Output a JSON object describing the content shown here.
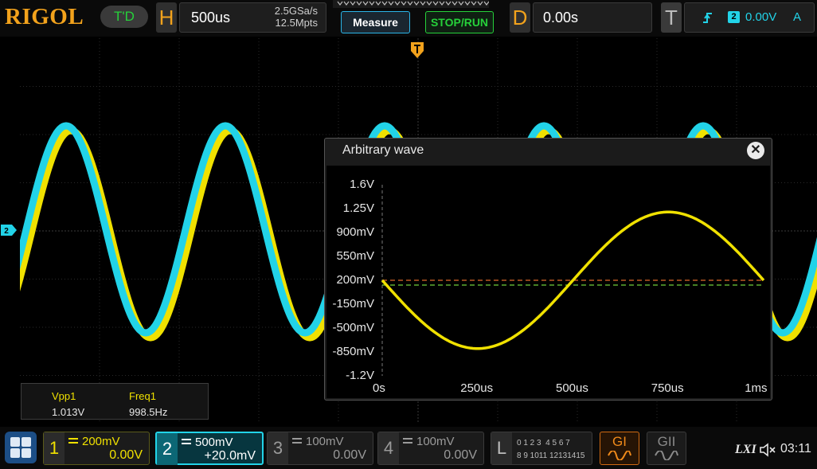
{
  "brand": "RIGOL",
  "trigger_status": "T'D",
  "horizontal": {
    "letter": "H",
    "timebase": "500us",
    "sample_rate": "2.5GSa/s",
    "memory_depth": "12.5Mpts"
  },
  "buttons": {
    "measure": "Measure",
    "stop_run": "STOP/RUN"
  },
  "delay": {
    "letter": "D",
    "value": "0.00s"
  },
  "trigger": {
    "letter": "T",
    "source": "2",
    "level": "0.00V",
    "mode": "A"
  },
  "channel_marker": "2",
  "measurements": [
    {
      "label": "Vpp1",
      "value": "1.013V"
    },
    {
      "label": "Freq1",
      "value": "998.5Hz"
    }
  ],
  "arb_window": {
    "title": "Arbitrary wave",
    "close_glyph": "✕"
  },
  "chart_data": {
    "type": "line",
    "title": "Arbitrary wave",
    "xlabel": "",
    "ylabel": "",
    "x_unit": "s",
    "y_unit": "V",
    "xlim": [
      0,
      0.001
    ],
    "ylim": [
      -1.2,
      1.6
    ],
    "x_tick_labels": [
      "0s",
      "250us",
      "500us",
      "750us",
      "1ms"
    ],
    "y_tick_labels": [
      "1.6V",
      "1.25V",
      "900mV",
      "550mV",
      "200mV",
      "-150mV",
      "-500mV",
      "-850mV",
      "-1.2V"
    ],
    "series": [
      {
        "waveform": "sine",
        "amplitude_v": 1.0,
        "offset_v": 0.2,
        "period_s": 0.001,
        "phase": "inverted",
        "color": "#f0e100"
      }
    ],
    "reference_lines": [
      {
        "y": 0.2,
        "color": "#e06a2a",
        "style": "dashed"
      },
      {
        "y": 0.13,
        "color": "#6fce3a",
        "style": "dashed"
      }
    ]
  },
  "main_display": {
    "traces": [
      {
        "channel": "1",
        "color": "#f0e100"
      },
      {
        "channel": "2",
        "color": "#22d3e8"
      }
    ]
  },
  "channels": [
    {
      "number": "1",
      "scale": "200mV",
      "offset": "0.00V",
      "color": "#f0e100",
      "active": false
    },
    {
      "number": "2",
      "scale": "500mV",
      "offset": "+20.0mV",
      "color": "#22d3e8",
      "active": true
    },
    {
      "number": "3",
      "scale": "100mV",
      "offset": "0.00V",
      "color": "#9a9a9a",
      "active": false
    },
    {
      "number": "4",
      "scale": "100mV",
      "offset": "0.00V",
      "color": "#9a9a9a",
      "active": false
    }
  ],
  "logic": {
    "letter": "L",
    "row1": "0 1 2 3  4 5 6 7",
    "row2": "8 9 1011 12131415"
  },
  "generators": [
    {
      "label": "GI",
      "icon": "sine-wave-icon",
      "active": true
    },
    {
      "label": "GII",
      "icon": "sine-wave-icon",
      "active": false
    }
  ],
  "status": {
    "lxi": "LXI",
    "time": "03:11",
    "speaker_icon": "speaker-muted-icon"
  }
}
